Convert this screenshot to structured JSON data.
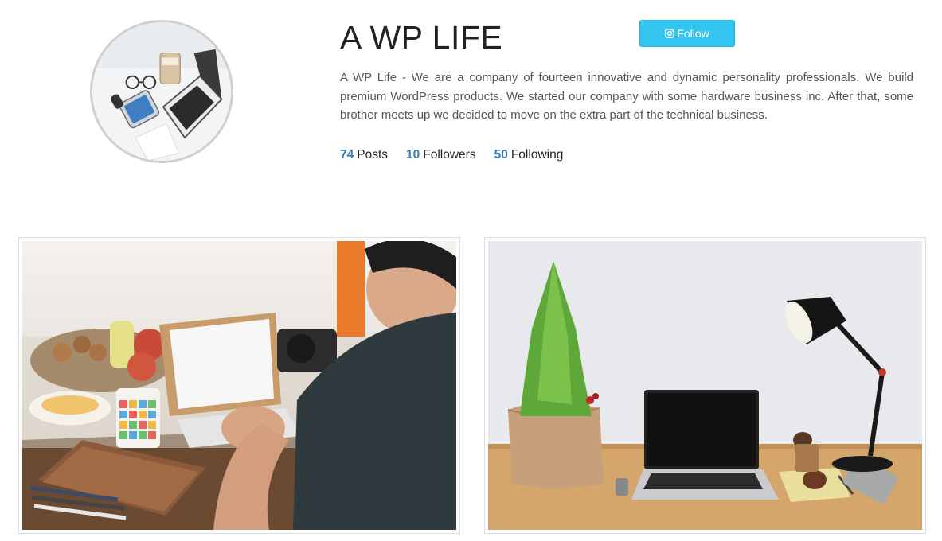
{
  "profile": {
    "name": "A WP LIFE",
    "bio": "A WP Life - We are a company of fourteen innovative and dynamic personality professionals. We build premium WordPress products. We started our company with some hardware business inc. After that, some brother meets up we decided to move on the extra part of the technical business.",
    "avatar_icon": "profile-photo-desk-laptop"
  },
  "follow_button": {
    "label": "Follow",
    "icon": "instagram-icon",
    "color": "#33c5f0"
  },
  "stats": [
    {
      "count": "74",
      "label": "Posts"
    },
    {
      "count": "10",
      "label": "Followers"
    },
    {
      "count": "50",
      "label": "Following"
    }
  ],
  "accent_color": "#3b7bb5",
  "posts": [
    {
      "image": "person-working-on-laptop-with-fruit-and-notebook"
    },
    {
      "image": "desk-with-plant-laptop-and-lamp"
    }
  ]
}
